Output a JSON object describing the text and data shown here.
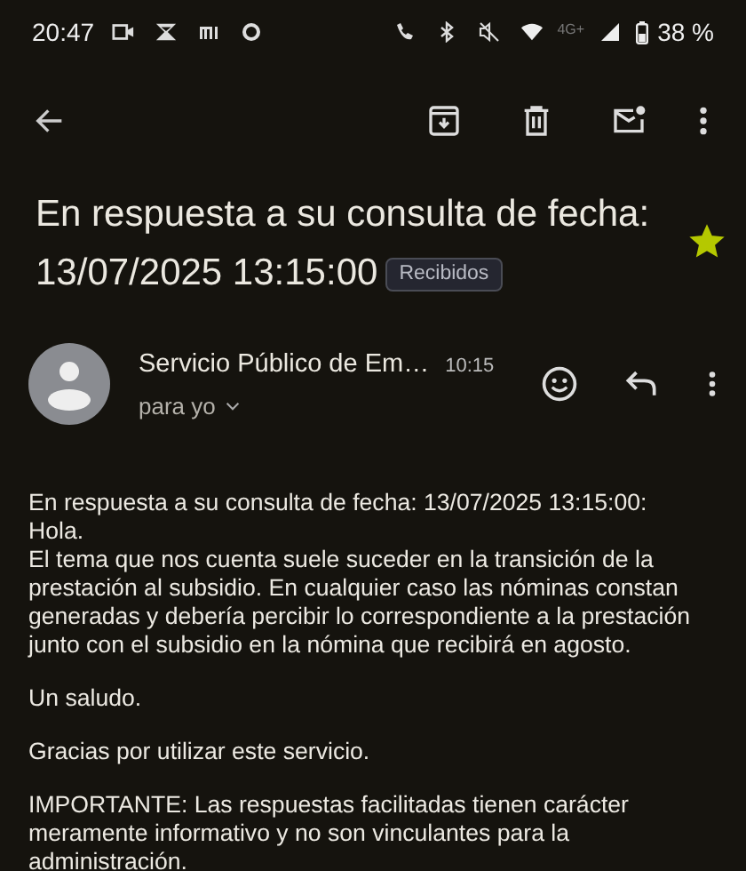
{
  "status_bar": {
    "time": "20:47",
    "network": "4G+",
    "battery": "38 %"
  },
  "subject": {
    "title": [
      "En respuesta a su consulta de fecha:",
      "13/07/2025 13:15:00"
    ],
    "label": "Recibidos",
    "starred": true
  },
  "message": {
    "sender": "Servicio Público de Em…",
    "time": "10:15",
    "recipient": "para yo",
    "body": [
      [
        "En respuesta a su consulta de fecha: 13/07/2025 13:15:00:",
        "Hola.",
        "El tema que nos cuenta suele suceder en la transición de la",
        "prestación al subsidio. En cualquier caso las nóminas constan",
        "generadas y debería percibir lo correspondiente a la prestación",
        "junto con el subsidio en la nómina que recibirá en agosto."
      ],
      [
        "Un saludo."
      ],
      [
        "Gracias por utilizar este servicio."
      ],
      [
        "IMPORTANTE: Las respuestas facilitadas tienen carácter",
        "meramente informativo y no son vinculantes para la",
        "administración."
      ]
    ]
  }
}
